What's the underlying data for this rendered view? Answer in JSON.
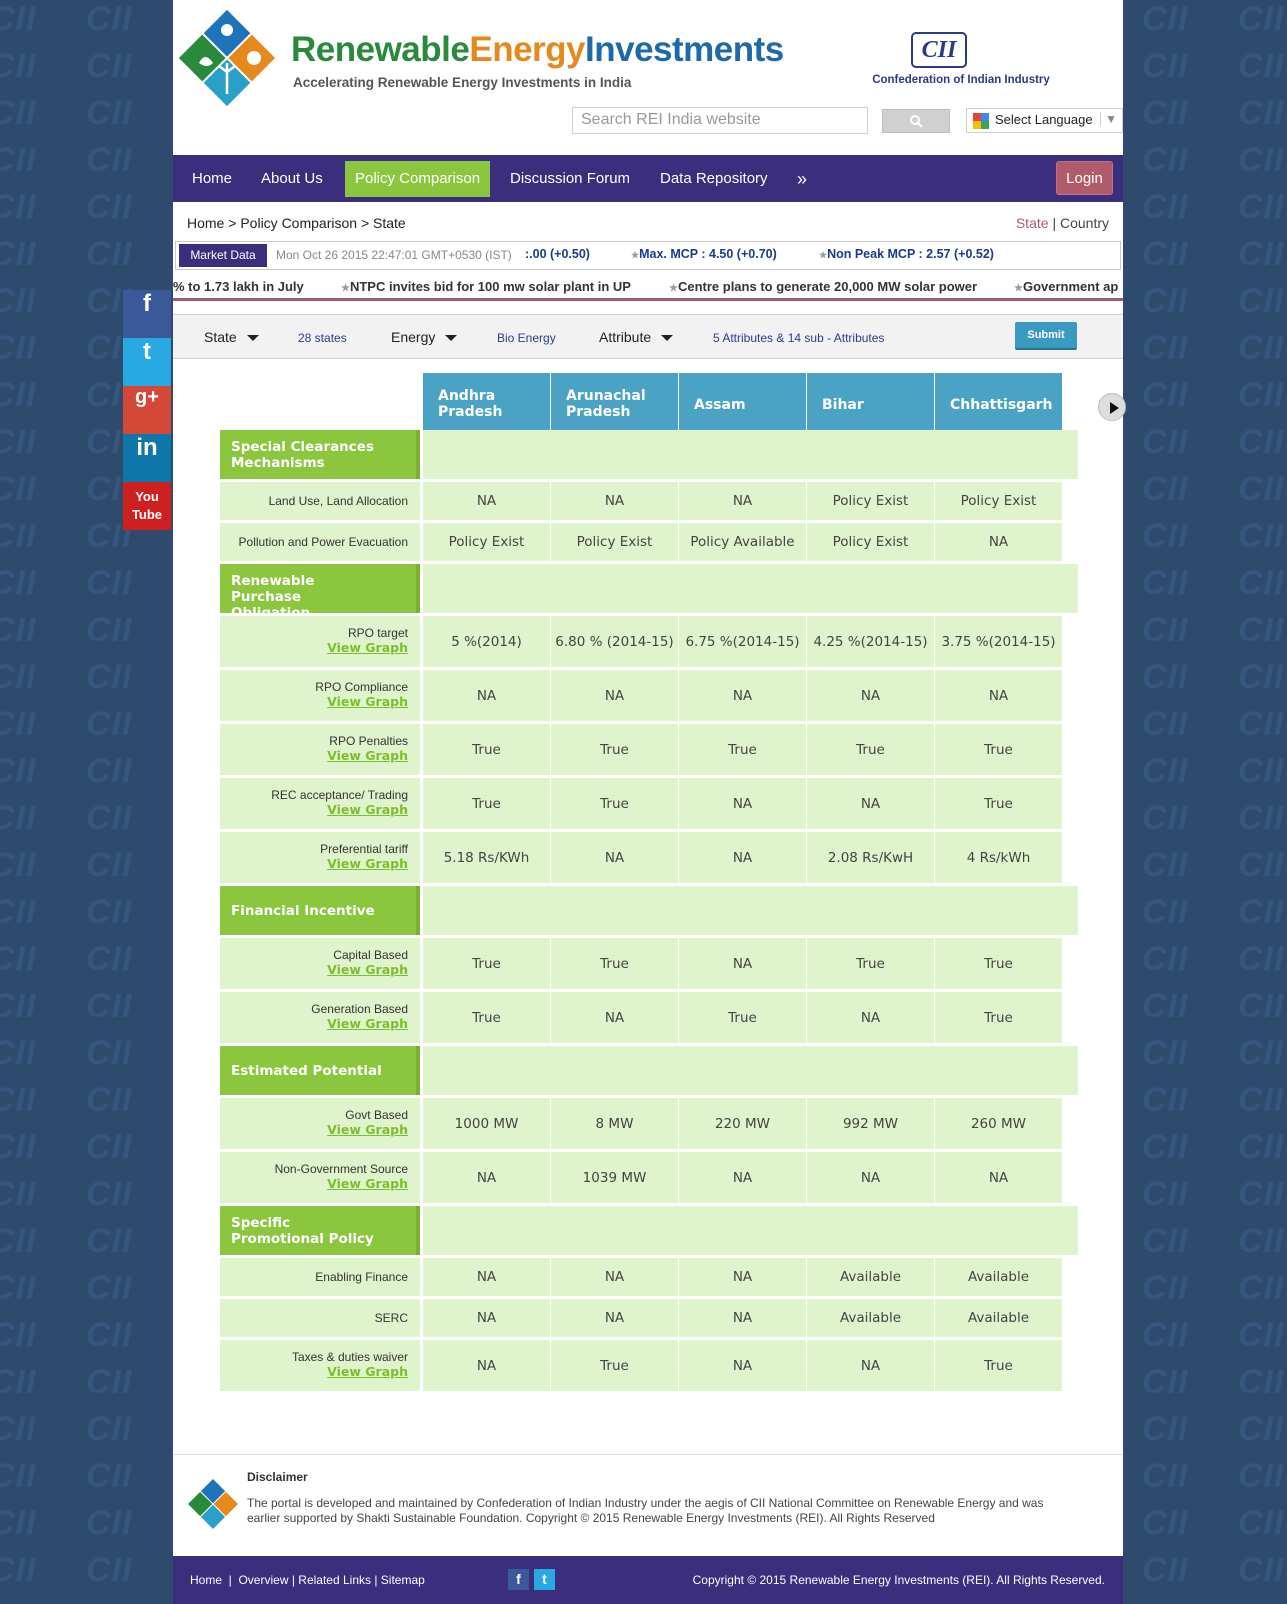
{
  "brand": {
    "title_part1": "Renewable",
    "title_part2": "Energy",
    "title_part3": "Investments",
    "tagline": "Accelerating Renewable Energy Investments in India",
    "partner_logo": "CII",
    "partner_name": "Confederation of Indian Industry"
  },
  "search": {
    "placeholder": "Search REI India website",
    "button_icon": "search-icon"
  },
  "language": {
    "label": "Select Language"
  },
  "nav": {
    "items": [
      "Home",
      "About Us",
      "Policy Comparison",
      "Discussion Forum",
      "Data Repository",
      "»"
    ],
    "active": "Policy Comparison",
    "login": "Login"
  },
  "breadcrumb": {
    "home": "Home",
    "sep1": ">",
    "policy": "Policy Comparison",
    "sep2": ">",
    "current": "State"
  },
  "view_switch": {
    "state": "State",
    "sep": "|",
    "country": "Country"
  },
  "market": {
    "label": "Market Data",
    "timestamp": "Mon Oct 26 2015 22:47:01 GMT+0530 (IST)",
    "items": [
      ":.00 (+0.50)",
      "Max. MCP : 4.50 (+0.70)",
      "Non Peak MCP : 2.57 (+0.52)"
    ]
  },
  "news": [
    "% to 1.73 lakh in July",
    "NTPC invites bid for 100 mw solar plant in UP",
    "Centre plans to generate 20,000 MW solar power",
    "Government ap"
  ],
  "filters": {
    "state_label": "State",
    "state_value": "28 states",
    "energy_label": "Energy",
    "energy_value": "Bio Energy",
    "attribute_label": "Attribute",
    "attribute_value": "5 Attributes & 14 sub - Attributes",
    "submit": "Submit"
  },
  "states": [
    "Andhra Pradesh",
    "Arunachal Pradesh",
    "Assam",
    "Bihar",
    "Chhattisgarh"
  ],
  "view_graph_label": "View Graph",
  "sections": [
    {
      "title": "Special Clearances Mechanisms",
      "rows": [
        {
          "label": "Land Use, Land Allocation",
          "graph": false,
          "values": [
            "NA",
            "NA",
            "NA",
            "Policy Exist",
            "Policy Exist"
          ]
        },
        {
          "label": "Pollution and Power Evacuation",
          "graph": false,
          "values": [
            "Policy Exist",
            "Policy Exist",
            "Policy Available",
            "Policy Exist",
            "NA"
          ]
        }
      ]
    },
    {
      "title": "Renewable Purchase Obligation",
      "rows": [
        {
          "label": "RPO target",
          "graph": true,
          "values": [
            "5 %(2014)",
            "6.80 % (2014-15)",
            "6.75 %(2014-15)",
            "4.25 %(2014-15)",
            "3.75 %(2014-15)"
          ]
        },
        {
          "label": "RPO Compliance",
          "graph": true,
          "values": [
            "NA",
            "NA",
            "NA",
            "NA",
            "NA"
          ]
        },
        {
          "label": "RPO Penalties",
          "graph": true,
          "values": [
            "True",
            "True",
            "True",
            "True",
            "True"
          ]
        },
        {
          "label": "REC acceptance/ Trading",
          "graph": true,
          "values": [
            "True",
            "True",
            "NA",
            "NA",
            "True"
          ]
        },
        {
          "label": "Preferential tariff",
          "graph": true,
          "values": [
            "5.18 Rs/KWh",
            "NA",
            "NA",
            "2.08 Rs/KwH",
            "4 Rs/kWh"
          ]
        }
      ]
    },
    {
      "title": "Financial Incentive",
      "rows": [
        {
          "label": "Capital Based",
          "graph": true,
          "values": [
            "True",
            "True",
            "NA",
            "True",
            "True"
          ]
        },
        {
          "label": "Generation Based",
          "graph": true,
          "values": [
            "True",
            "NA",
            "True",
            "NA",
            "True"
          ]
        }
      ]
    },
    {
      "title": "Estimated Potential",
      "rows": [
        {
          "label": "Govt Based",
          "graph": true,
          "values": [
            "1000 MW",
            "8 MW",
            "220 MW",
            "992 MW",
            "260 MW"
          ]
        },
        {
          "label": "Non-Government Source",
          "graph": true,
          "values": [
            "NA",
            "1039 MW",
            "NA",
            "NA",
            "NA"
          ]
        }
      ]
    },
    {
      "title": "Specific Promotional Policy",
      "rows": [
        {
          "label": "Enabling Finance",
          "graph": false,
          "values": [
            "NA",
            "NA",
            "NA",
            "Available",
            "Available"
          ]
        },
        {
          "label": "SERC",
          "graph": false,
          "values": [
            "NA",
            "NA",
            "NA",
            "Available",
            "Available"
          ]
        },
        {
          "label": "Taxes & duties waiver",
          "graph": true,
          "values": [
            "NA",
            "True",
            "NA",
            "NA",
            "True"
          ]
        }
      ]
    }
  ],
  "footer": {
    "disclaimer_title": "Disclaimer",
    "disclaimer_text": "The portal is developed and maintained by Confederation of Indian Industry under the aegis of CII National Committee on Renewable Energy and was earlier supported by Shakti Sustainable Foundation. Copyright © 2015 Renewable Energy Investments (REI). All Rights Reserved",
    "links": [
      "Home",
      "Overview",
      "Related Links",
      "Sitemap"
    ],
    "copyright": "Copyright © 2015 Renewable Energy Investments (REI). All Rights Reserved."
  },
  "social": [
    "f",
    "t",
    "g+",
    "in",
    "You Tube"
  ],
  "colors": {
    "nav": "#3a2e7d",
    "accent_green": "#8cc63f",
    "header_blue": "#4aa3c4",
    "cell_green": "#dff3cc",
    "login": "#b05a6c"
  }
}
